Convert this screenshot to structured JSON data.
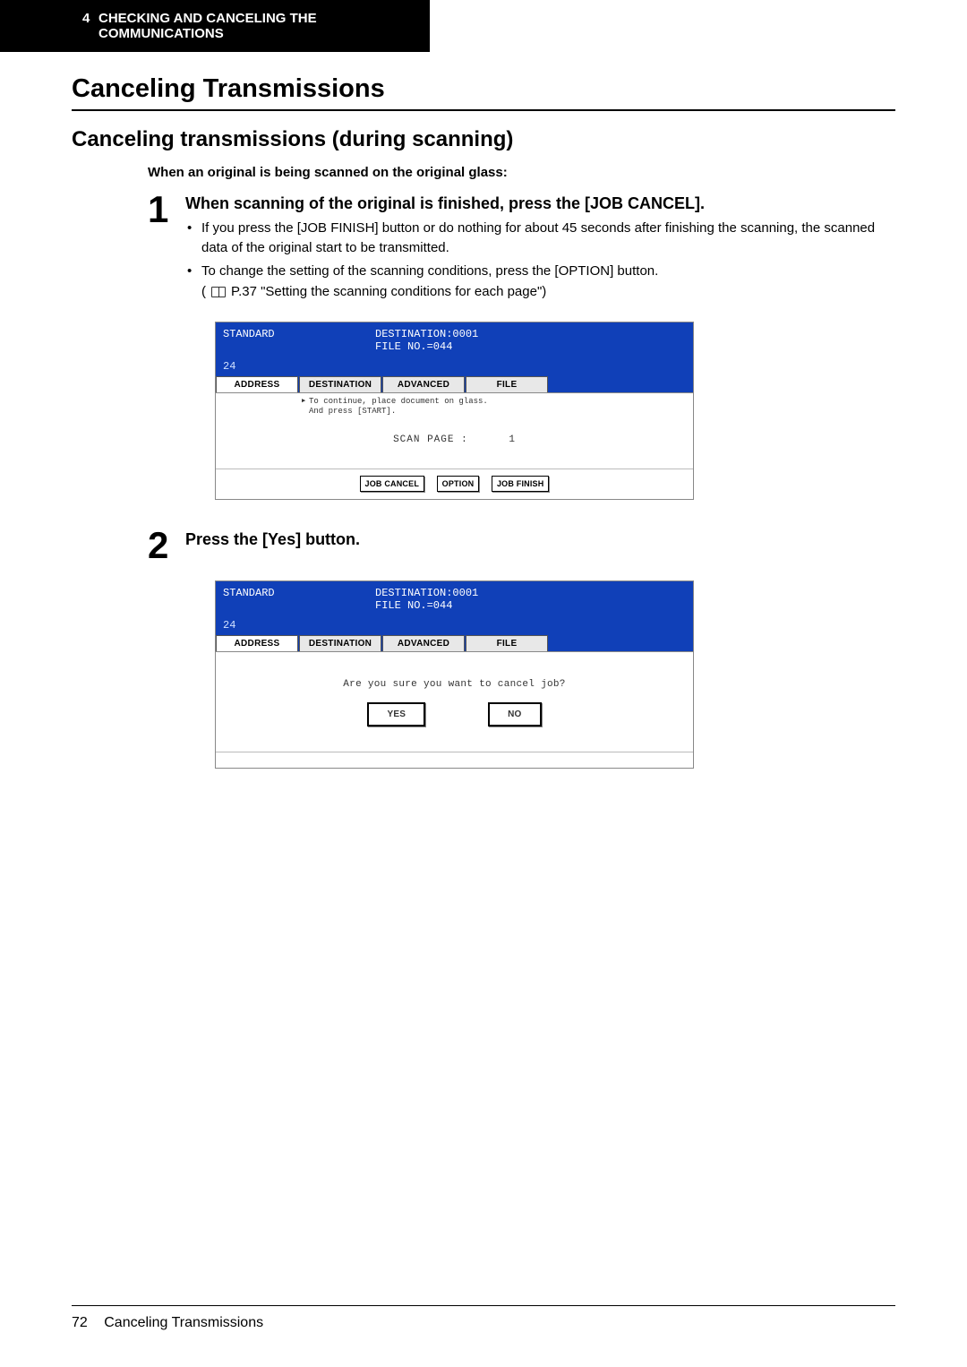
{
  "header": {
    "chapter_num": "4",
    "chapter_title": "CHECKING AND CANCELING THE COMMUNICATIONS"
  },
  "h1": "Canceling Transmissions",
  "h2": "Canceling transmissions (during scanning)",
  "intro": "When an original is being scanned on the original glass:",
  "step1": {
    "num": "1",
    "heading": "When scanning of the original is finished, press the [JOB CANCEL].",
    "b1": "If you press the [JOB FINISH] button or do nothing for about 45 seconds after finishing the scanning, the scanned data of the original start to be transmitted.",
    "b2": "To change the setting of the scanning conditions, press the [OPTION] button.",
    "ref": "P.37 \"Setting the scanning conditions for each page\")"
  },
  "step2": {
    "num": "2",
    "heading": "Press the [Yes] button."
  },
  "lcd_common": {
    "standard": "STANDARD",
    "dest_line": "DESTINATION:0001",
    "file_line": "FILE NO.=044",
    "code": "24",
    "tabs": {
      "address": "ADDRESS",
      "destination": "DESTINATION",
      "advanced": "ADVANCED",
      "file": "FILE"
    }
  },
  "lcd1": {
    "msg1": "To continue, place document on glass.",
    "msg2": "And press [START].",
    "scan_label": "SCAN PAGE :",
    "scan_val": "1",
    "btns": {
      "cancel": "JOB CANCEL",
      "option": "OPTION",
      "finish": "JOB FINISH"
    }
  },
  "lcd2": {
    "confirm": "Are you sure you want to cancel job?",
    "yes": "YES",
    "no": "NO"
  },
  "footer": {
    "page": "72",
    "title": "Canceling Transmissions"
  }
}
